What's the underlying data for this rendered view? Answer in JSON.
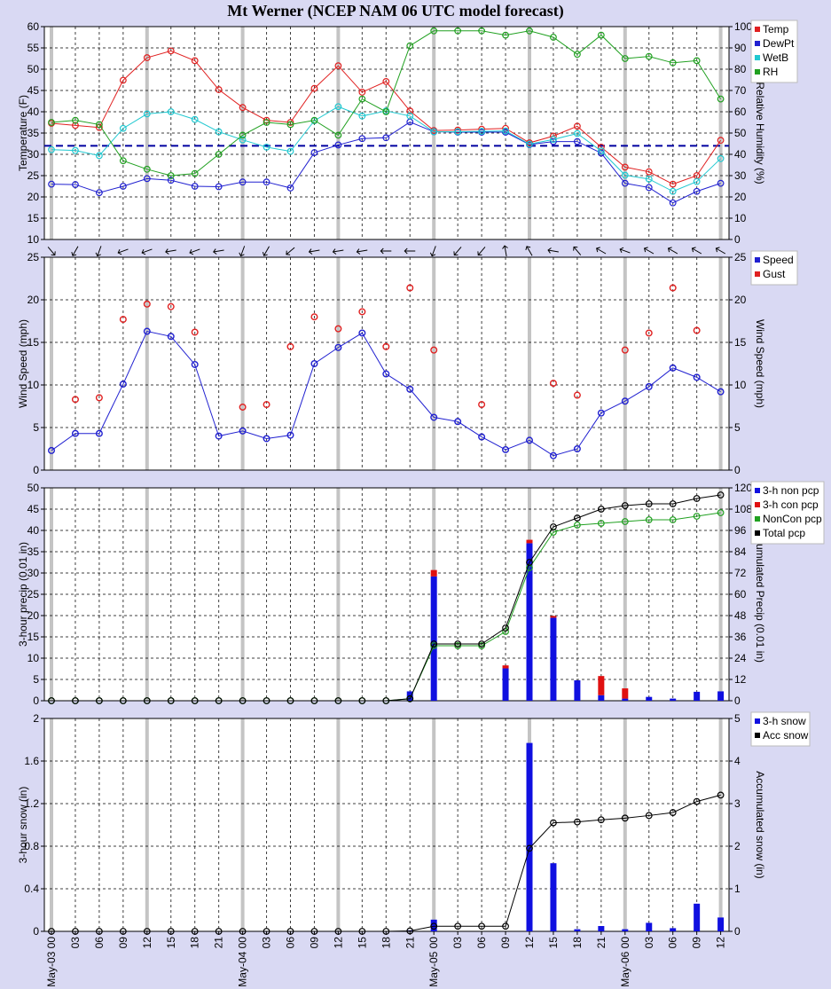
{
  "title": "Mt Werner (NCEP NAM 06 UTC model forecast)",
  "x_labels": [
    "May-03 00",
    "03",
    "06",
    "09",
    "12",
    "15",
    "18",
    "21",
    "May-04 00",
    "03",
    "06",
    "09",
    "12",
    "15",
    "18",
    "21",
    "May-05 00",
    "03",
    "06",
    "09",
    "12",
    "15",
    "18",
    "21",
    "May-06 00",
    "03",
    "06",
    "09",
    "12"
  ],
  "chart_data": [
    {
      "type": "line",
      "ylabel": "Temperature (F)",
      "y2label": "Relative Humidity (%)",
      "ylim": [
        10,
        60
      ],
      "y2lim": [
        0,
        100
      ],
      "yticks": [
        10,
        15,
        20,
        25,
        30,
        35,
        40,
        45,
        50,
        55,
        60
      ],
      "y2ticks": [
        0,
        10,
        20,
        30,
        40,
        50,
        60,
        70,
        80,
        90,
        100
      ],
      "freezing_line": 32,
      "series": [
        {
          "name": "Temp",
          "color": "#e02020",
          "axis": "left",
          "values": [
            37.3,
            36.8,
            36.3,
            47.4,
            52.7,
            54.3,
            52.0,
            45.2,
            41.0,
            38.0,
            37.5,
            45.5,
            50.8,
            44.6,
            47.1,
            40.2,
            35.6,
            35.7,
            35.9,
            36.1,
            32.7,
            34.3,
            36.6,
            31.7,
            27.0,
            25.9,
            23.0,
            25.0,
            33.3
          ]
        },
        {
          "name": "DewPt",
          "color": "#2020d0",
          "axis": "left",
          "values": [
            23.0,
            22.9,
            21.0,
            22.5,
            24.3,
            23.9,
            22.5,
            22.4,
            23.5,
            23.5,
            22.1,
            30.4,
            32.2,
            33.7,
            33.9,
            37.6,
            35.3,
            35.2,
            35.2,
            35.2,
            32.3,
            33.0,
            33.0,
            30.3,
            23.2,
            22.2,
            18.6,
            21.3,
            23.2
          ]
        },
        {
          "name": "WetB",
          "color": "#20c8d0",
          "axis": "left",
          "values": [
            31.1,
            30.9,
            29.7,
            36.1,
            39.5,
            40.0,
            38.2,
            35.3,
            33.4,
            31.7,
            30.7,
            37.9,
            41.2,
            39.0,
            40.2,
            39.0,
            35.3,
            35.3,
            35.4,
            35.5,
            32.4,
            33.5,
            34.9,
            30.8,
            25.1,
            24.2,
            21.3,
            23.6,
            29.0
          ]
        },
        {
          "name": "RH",
          "color": "#20a020",
          "axis": "right",
          "values": [
            55,
            56,
            54,
            37,
            33,
            30,
            31,
            40,
            49,
            55,
            54,
            56,
            49,
            66,
            60,
            91,
            98,
            98,
            98,
            96,
            98,
            95,
            87,
            96,
            85,
            86,
            83,
            84,
            66
          ]
        }
      ]
    },
    {
      "type": "scatter",
      "ylabel": "Wind Speed (mph)",
      "y2label": "Wind Speed (mph)",
      "ylim": [
        0,
        25
      ],
      "yticks": [
        0,
        5,
        10,
        15,
        20,
        25
      ],
      "wind_dir": [
        140,
        210,
        200,
        250,
        250,
        260,
        250,
        260,
        200,
        210,
        230,
        260,
        260,
        260,
        270,
        270,
        200,
        220,
        220,
        350,
        330,
        280,
        320,
        300,
        290,
        300,
        300,
        300,
        300
      ],
      "series": [
        {
          "name": "Speed",
          "color": "#2020d0",
          "values": [
            2.3,
            4.3,
            4.3,
            10.1,
            16.3,
            15.7,
            12.4,
            4.0,
            4.6,
            3.7,
            4.1,
            12.5,
            14.4,
            16.1,
            11.3,
            9.5,
            6.2,
            5.7,
            3.9,
            2.4,
            3.5,
            1.7,
            2.5,
            6.7,
            8.1,
            9.8,
            12.0,
            10.9,
            9.2
          ]
        },
        {
          "name": "Gust",
          "color": "#e02020",
          "values": [
            null,
            8.3,
            8.5,
            17.7,
            19.5,
            19.2,
            16.2,
            null,
            7.4,
            7.7,
            14.5,
            18.0,
            16.6,
            18.6,
            14.5,
            21.4,
            14.1,
            null,
            7.7,
            null,
            null,
            10.2,
            8.8,
            null,
            14.1,
            16.1,
            21.4,
            16.4,
            null
          ]
        }
      ]
    },
    {
      "type": "bar",
      "ylabel": "3-hour precip (0.01 in)",
      "y2label": "Accumulated Precip (0.01 in)",
      "ylim": [
        0,
        50
      ],
      "y2lim": [
        0,
        120
      ],
      "yticks": [
        0,
        5,
        10,
        15,
        20,
        25,
        30,
        35,
        40,
        45,
        50
      ],
      "y2ticks": [
        0,
        12,
        24,
        36,
        48,
        60,
        72,
        84,
        96,
        108,
        120
      ],
      "series": [
        {
          "name": "3-h non pcp",
          "color": "#1010e0",
          "values": [
            0,
            0,
            0,
            0,
            0,
            0,
            0,
            0,
            0,
            0,
            0,
            0,
            0,
            0,
            0,
            2.2,
            29.2,
            0,
            0,
            7.6,
            37.0,
            19.5,
            4.8,
            1.3,
            0.5,
            0.9,
            0.5,
            2.1,
            2.2
          ]
        },
        {
          "name": "3-h con pcp",
          "color": "#e01010",
          "values": [
            0,
            0,
            0,
            0,
            0,
            0,
            0,
            0,
            0,
            0,
            0,
            0,
            0,
            0,
            0,
            0,
            1.5,
            0,
            0,
            0.7,
            0.8,
            0.4,
            0,
            4.5,
            2.4,
            0,
            0,
            0,
            0
          ]
        },
        {
          "name": "NonCon pcp",
          "color": "#20a020",
          "values": [
            0,
            0,
            0,
            0,
            0,
            0,
            0,
            0,
            0,
            0,
            0,
            0,
            0,
            0,
            0,
            1.1,
            31,
            31,
            31,
            39,
            75,
            95,
            99,
            100,
            101,
            102,
            102,
            104,
            106
          ]
        },
        {
          "name": "Total pcp",
          "color": "#000000",
          "values": [
            0,
            0,
            0,
            0,
            0,
            0,
            0,
            0,
            0,
            0,
            0,
            0,
            0,
            0,
            0,
            1.1,
            32,
            32,
            32,
            41,
            78,
            98,
            103,
            108,
            110,
            111,
            111,
            114,
            116
          ]
        }
      ]
    },
    {
      "type": "bar",
      "ylabel": "3-hour snow (in)",
      "y2label": "Accumulated snow (in)",
      "ylim": [
        0,
        2
      ],
      "y2lim": [
        0,
        5
      ],
      "yticks": [
        0,
        0.4,
        0.8,
        1.2,
        1.6,
        2
      ],
      "y2ticks": [
        0,
        1,
        2,
        3,
        4,
        5
      ],
      "series": [
        {
          "name": "3-h snow",
          "color": "#1010e0",
          "values": [
            0,
            0,
            0,
            0,
            0,
            0,
            0,
            0,
            0,
            0,
            0,
            0,
            0,
            0,
            0,
            0.01,
            0.11,
            0,
            0,
            0,
            1.77,
            0.64,
            0.02,
            0.05,
            0.02,
            0.08,
            0.03,
            0.26,
            0.13
          ]
        },
        {
          "name": "Acc snow",
          "color": "#000000",
          "values": [
            0,
            0,
            0,
            0,
            0,
            0,
            0,
            0,
            0,
            0,
            0,
            0,
            0,
            0,
            0,
            0.01,
            0.12,
            0.12,
            0.12,
            0.12,
            1.95,
            2.55,
            2.57,
            2.62,
            2.66,
            2.72,
            2.79,
            3.05,
            3.2
          ]
        }
      ]
    }
  ]
}
